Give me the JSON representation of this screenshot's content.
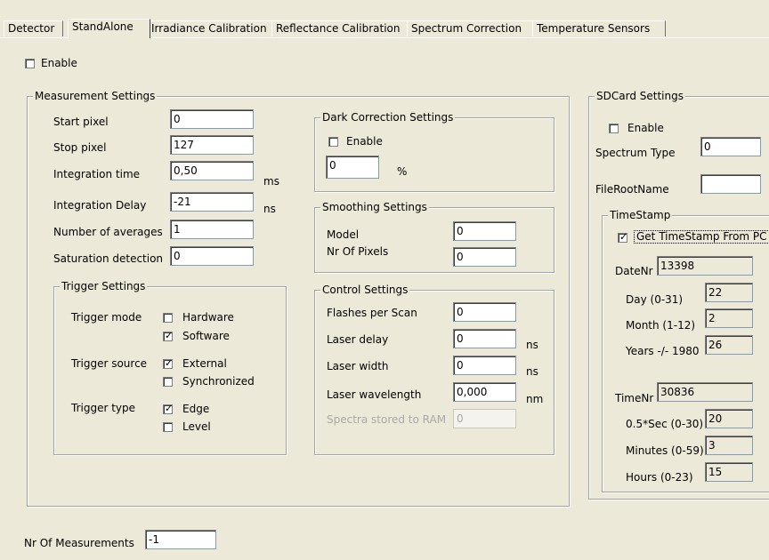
{
  "tabs": [
    "Detector",
    "StandAlone",
    "Irradiance Calibration",
    "Reflectance Calibration",
    "Spectrum Correction",
    "Temperature Sensors"
  ],
  "enable_label": "Enable",
  "measurement": {
    "legend": "Measurement Settings",
    "start_pixel_label": "Start pixel",
    "start_pixel": "0",
    "stop_pixel_label": "Stop pixel",
    "stop_pixel": "127",
    "integration_time_label": "Integration time",
    "integration_time": "0,50",
    "integration_time_unit": "ms",
    "integration_delay_label": "Integration Delay",
    "integration_delay": "-21",
    "integration_delay_unit": "ns",
    "num_averages_label": "Number of averages",
    "num_averages": "1",
    "saturation_label": "Saturation detection",
    "saturation": "0"
  },
  "trigger": {
    "legend": "Trigger Settings",
    "mode_label": "Trigger mode",
    "hardware": "Hardware",
    "software": "Software",
    "source_label": "Trigger source",
    "external": "External",
    "synchronized": "Synchronized",
    "type_label": "Trigger type",
    "edge": "Edge",
    "level": "Level"
  },
  "dark": {
    "legend": "Dark Correction Settings",
    "enable_label": "Enable",
    "value": "0",
    "unit": "%"
  },
  "smoothing": {
    "legend": "Smoothing Settings",
    "model_label": "Model",
    "model": "0",
    "nr_pixels_label": "Nr Of Pixels",
    "nr_pixels": "0"
  },
  "control": {
    "legend": "Control Settings",
    "flashes_label": "Flashes per Scan",
    "flashes": "0",
    "laser_delay_label": "Laser delay",
    "laser_delay": "0",
    "laser_delay_unit": "ns",
    "laser_width_label": "Laser width",
    "laser_width": "0",
    "laser_width_unit": "ns",
    "laser_wavelength_label": "Laser wavelength",
    "laser_wavelength": "0,000",
    "laser_wavelength_unit": "nm",
    "spectra_ram_label": "Spectra stored to RAM",
    "spectra_ram": "0"
  },
  "sdcard": {
    "legend": "SDCard Settings",
    "enable_label": "Enable",
    "spectrum_type_label": "Spectrum Type",
    "spectrum_type": "0",
    "file_root_label": "FileRootName",
    "file_root": ""
  },
  "timestamp": {
    "legend": "TimeStamp",
    "get_from_pc": "Get TimeStamp From PC",
    "datenr_label": "DateNr",
    "datenr": "13398",
    "day_label": "Day (0-31)",
    "day": "22",
    "month_label": "Month (1-12)",
    "month": "2",
    "years_label": "Years -/- 1980",
    "years": "26",
    "timenr_label": "TimeNr",
    "timenr": "30836",
    "halfsec_label": "0.5*Sec (0-30)",
    "halfsec": "20",
    "minutes_label": "Minutes (0-59)",
    "minutes": "3",
    "hours_label": "Hours (0-23)",
    "hours": "15"
  },
  "nr_measurements_label": "Nr Of Measurements",
  "nr_measurements": "-1"
}
